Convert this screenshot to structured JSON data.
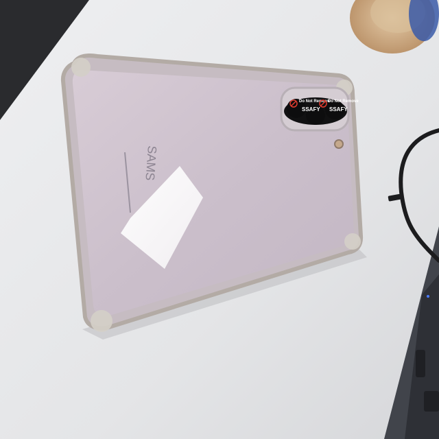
{
  "scene": {
    "kind": "photo",
    "subject": "phone-in-clear-case",
    "colors": {
      "desk": "#e6e7e9",
      "phone_back": "#cbbfc9",
      "case_edge": "#b9b3ab",
      "sticker": "#1a1a1a",
      "sticker_icon": "#e23b2e",
      "cable": "#1c1c1e",
      "laptop": "#3a3d44",
      "cup": "#c9a27a"
    }
  },
  "stickers": [
    {
      "line1": "Do Not Remove",
      "line2": "SSAFY"
    },
    {
      "line1": "Do Not Remove",
      "line2": "SSAFY"
    }
  ],
  "brand_partial": "SAMS"
}
